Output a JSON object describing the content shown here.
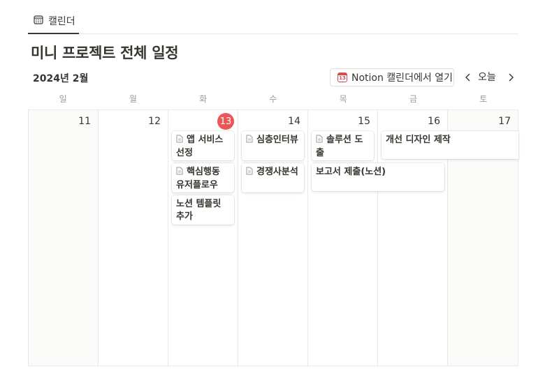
{
  "tab": {
    "label": "캘린더",
    "icon": "calendar-icon"
  },
  "page": {
    "title": "미니 프로젝트 전체 일정"
  },
  "toolbar": {
    "month": "2024년 2월",
    "open_in_notion": "Notion 캘린더에서 열기",
    "open_in_notion_icon_num": "13",
    "today": "오늘",
    "prev_icon": "chevron-left-icon",
    "next_icon": "chevron-right-icon"
  },
  "weekdays": [
    "일",
    "월",
    "화",
    "수",
    "목",
    "금",
    "토"
  ],
  "days": [
    "11",
    "12",
    "13",
    "14",
    "15",
    "16",
    "17"
  ],
  "today_index": 2,
  "colors": {
    "today": "#eb5757",
    "accent": "#d44c47",
    "text": "#37352f",
    "muted": "#9b9a97"
  },
  "events": {
    "tue_1": "앱 서비스 선정",
    "tue_2": "핵심행동 유저플로우",
    "tue_3": "노션 템플릿 추가",
    "wed_1": "심층인터뷰",
    "wed_2": "경쟁사분석",
    "thu_1": "솔루션 도출",
    "thu_fri": "보고서 제출(노션)",
    "fri_sat": "개선 디자인 제작"
  }
}
